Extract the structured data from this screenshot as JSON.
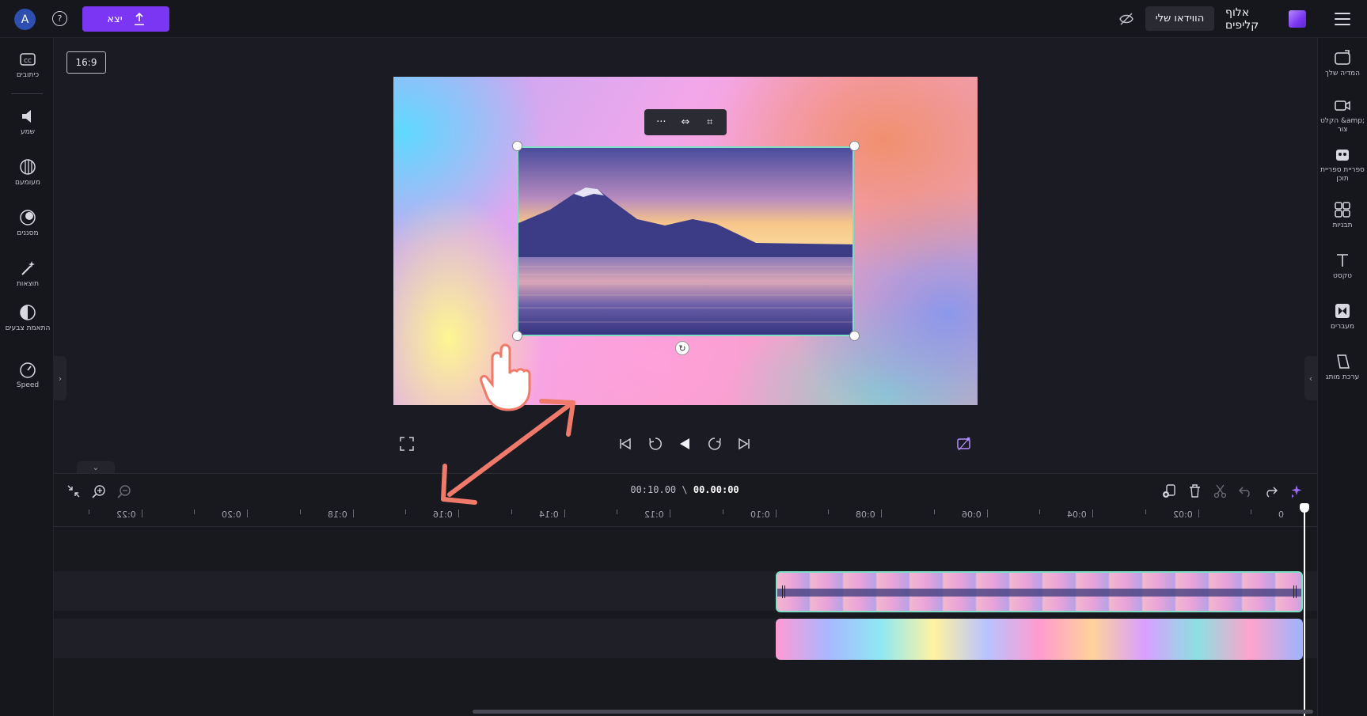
{
  "topbar": {
    "avatar_initial": "A",
    "help_glyph": "?",
    "export_label": "יצא",
    "my_videos_label": "הווידאו שלי",
    "brand_name": "אלוף קליפים",
    "accent_color": "#7a36f2"
  },
  "left_sidebar": {
    "items": [
      {
        "label": "כיתובים",
        "icon": "captions-icon"
      },
      {
        "label": "שמע",
        "icon": "audio-icon"
      },
      {
        "label": "מעומעם",
        "icon": "fade-icon"
      },
      {
        "label": "מסננים",
        "icon": "filters-icon"
      },
      {
        "label": "תוצאות",
        "icon": "effects-icon"
      },
      {
        "label": "התאמת צבעים",
        "icon": "color-adjust-icon"
      },
      {
        "label": "Speed",
        "icon": "speed-icon"
      }
    ]
  },
  "right_sidebar": {
    "items": [
      {
        "label": "המדיה שלך",
        "icon": "media-folder-icon"
      },
      {
        "label": "הקלט &amp; צור",
        "icon": "record-icon"
      },
      {
        "label": "ספריית ספריית תוכן",
        "icon": "content-library-icon"
      },
      {
        "label": "תבניות",
        "icon": "templates-icon"
      },
      {
        "label": "טקסט",
        "icon": "text-icon"
      },
      {
        "label": "מעברים",
        "icon": "transitions-icon"
      },
      {
        "label": "ערכת מותג",
        "icon": "brand-kit-icon"
      }
    ]
  },
  "stage": {
    "aspect_ratio": "16:9",
    "floating_toolbar": [
      "more-icon",
      "fit-icon",
      "crop-icon"
    ]
  },
  "timeline": {
    "current_time": "00.00:00",
    "total_time": "00:10.00",
    "ruler_labels": [
      "0",
      "0:02",
      "0:04",
      "0:06",
      "0:08",
      "0:10",
      "0:12",
      "0:14",
      "0:16",
      "0:18",
      "0:20",
      "0:22"
    ]
  }
}
